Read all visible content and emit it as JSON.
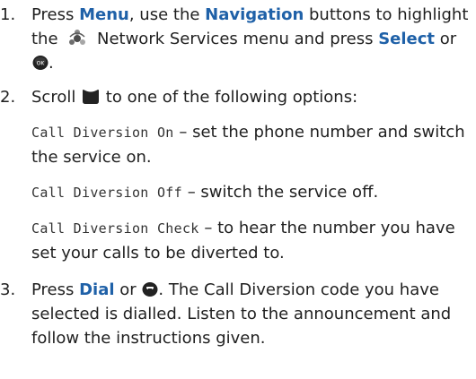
{
  "steps": [
    {
      "num": "1.",
      "t1": "Press ",
      "k1": "Menu",
      "t2": ", use the ",
      "k2": "Navigation",
      "t3": " buttons to highlight the ",
      "t4": " Network Services menu and press ",
      "k3": "Select",
      "t5": " or ",
      "t6": "."
    },
    {
      "num": "2.",
      "t1": "Scroll ",
      "t2": " to one of the following options:",
      "options": [
        {
          "code": "Call Diversion On",
          "desc": " – set the phone number and switch the service on."
        },
        {
          "code": "Call Diversion Off",
          "desc": " – switch the service off."
        },
        {
          "code": "Call Diversion Check",
          "desc": " – to hear the number you have set your calls to be diverted to."
        }
      ]
    },
    {
      "num": "3.",
      "t1": "Press ",
      "k1": "Dial",
      "t2": " or ",
      "t3": ". The Call Diversion code you have selected is dialled. Listen to the announcement and follow the instructions given."
    }
  ],
  "icons": {
    "network": "network-services-icon",
    "ok": "ok-key-icon",
    "nav": "navigation-key-icon",
    "call": "call-key-icon"
  },
  "colors": {
    "keyword": "#1f61a8",
    "text": "#1f1f1f",
    "key": "#222222"
  }
}
